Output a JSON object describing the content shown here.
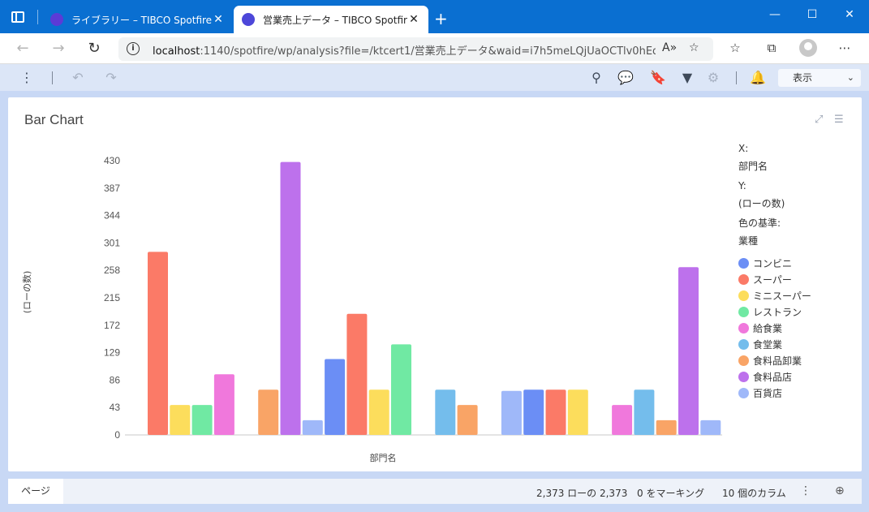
{
  "browser": {
    "tabs": [
      {
        "label": "ライブラリー – TIBCO Spotfire",
        "active": false
      },
      {
        "label": "営業売上データ – TIBCO Spotfire",
        "active": true
      }
    ],
    "url_host": "localhost",
    "url_rest": ":1140/spotfire/wp/analysis?file=/ktcert1/営業売上データ&waid=i7h5meLQjUaOCTlv0hEq..."
  },
  "toolbar": {
    "show_label": "表示"
  },
  "visualization": {
    "title": "Bar Chart"
  },
  "legend": {
    "x_key": "X:",
    "x_value": "部門名",
    "y_key": "Y:",
    "y_value": "(ローの数)",
    "color_key": "色の基準:",
    "color_value": "業種",
    "items": [
      {
        "label": "コンビニ",
        "color": "#6b8ef5"
      },
      {
        "label": "スーパー",
        "color": "#fb7a67"
      },
      {
        "label": "ミニスーパー",
        "color": "#fcdd5c"
      },
      {
        "label": "レストラン",
        "color": "#70e9a3"
      },
      {
        "label": "給食業",
        "color": "#f078dc"
      },
      {
        "label": "食堂業",
        "color": "#74bdec"
      },
      {
        "label": "食料品卸業",
        "color": "#f9a466"
      },
      {
        "label": "食料品店",
        "color": "#bd71ec"
      },
      {
        "label": "百貨店",
        "color": "#9fb8f9"
      }
    ]
  },
  "chart_data": {
    "type": "bar",
    "xlabel": "部門名",
    "ylabel": "(ローの数)",
    "ylim": [
      0,
      430
    ],
    "yticks": [
      0,
      43,
      86,
      129,
      172,
      215,
      258,
      301,
      344,
      387,
      430
    ],
    "grid": false,
    "legend_position": "right",
    "groups": [
      {
        "category": "",
        "bars": [
          {
            "series": "スーパー",
            "value": 287
          },
          {
            "series": "ミニスーパー",
            "value": 47
          },
          {
            "series": "レストラン",
            "value": 47
          },
          {
            "series": "給食業",
            "value": 95
          }
        ]
      },
      {
        "category": "",
        "bars": [
          {
            "series": "食料品卸業",
            "value": 71
          },
          {
            "series": "食料品店",
            "value": 428
          },
          {
            "series": "百貨店",
            "value": 23
          },
          {
            "series": "コンビニ",
            "value": 119
          },
          {
            "series": "スーパー",
            "value": 190
          },
          {
            "series": "ミニスーパー",
            "value": 71
          },
          {
            "series": "レストラン",
            "value": 142
          }
        ]
      },
      {
        "category": "",
        "bars": [
          {
            "series": "食堂業",
            "value": 71
          },
          {
            "series": "食料品卸業",
            "value": 47
          }
        ]
      },
      {
        "category": "",
        "bars": [
          {
            "series": "百貨店",
            "value": 69
          },
          {
            "series": "コンビニ",
            "value": 71
          },
          {
            "series": "スーパー",
            "value": 71
          },
          {
            "series": "ミニスーパー",
            "value": 71
          }
        ]
      },
      {
        "category": "",
        "bars": [
          {
            "series": "給食業",
            "value": 47
          },
          {
            "series": "食堂業",
            "value": 71
          },
          {
            "series": "食料品卸業",
            "value": 23
          },
          {
            "series": "食料品店",
            "value": 263
          },
          {
            "series": "百貨店",
            "value": 23
          }
        ]
      }
    ]
  },
  "status": {
    "page_tab": "ページ",
    "rows": "2,373 ローの 2,373",
    "marked": "0 をマーキング",
    "columns": "10 個のカラム"
  }
}
